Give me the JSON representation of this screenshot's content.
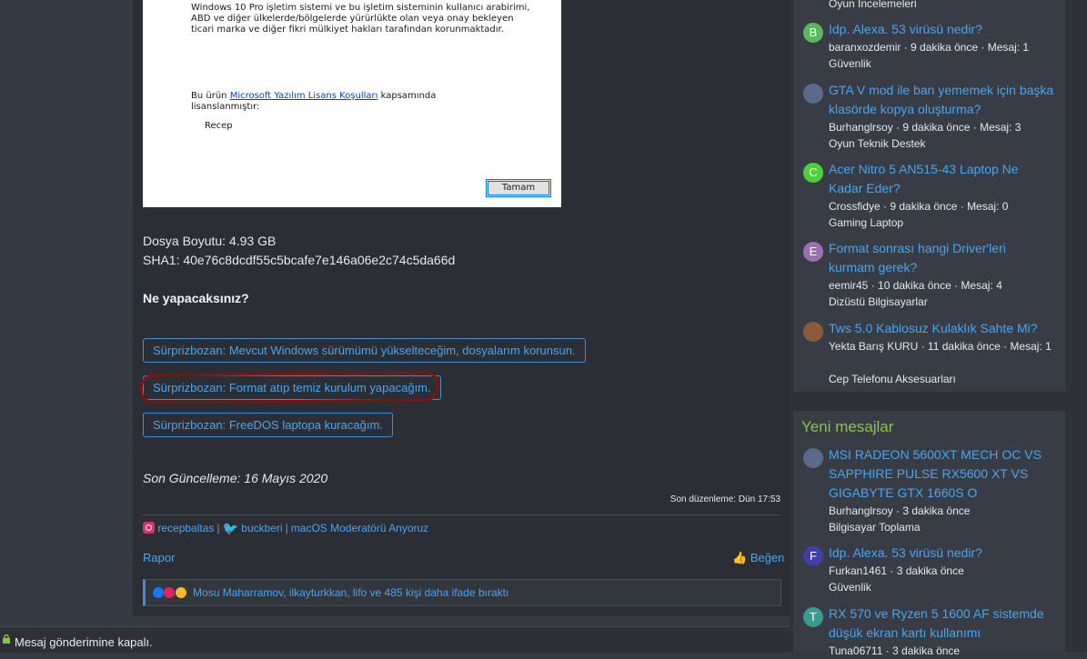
{
  "dialog": {
    "legal_text": "Windows 10 Pro işletim sistemi ve bu işletim sisteminin kullanıcı arabirimi, ABD ve diğer ülkelerde/bölgelerde yürürlükte olan veya onay bekleyen ticari marka ve diğer fikri mülkiyet hakları tarafından korunmaktadır.",
    "license_prefix": "Bu ürün ",
    "license_link": "Microsoft Yazılım Lisans Koşulları",
    "license_suffix": " kapsamında lisanslanmıştır:",
    "user": "Recep",
    "ok_label": "Tamam"
  },
  "post": {
    "file_size": "Dosya Boyutu: 4.93 GB",
    "sha1": "SHA1: 40e76c8dcdf55c5bcafe7e146a06e2c74c5da66d",
    "question": "Ne yapacaksınız?",
    "choices": [
      "Sürprizbozan: Mevcut Windows sürümümü yükselteceğim, dosyalarım korunsun.",
      "Sürprizbozan: Format atıp temiz kurulum yapacağım.",
      "Sürprizbozan: FreeDOS laptopa kuracağım."
    ],
    "last_update": "Son Güncelleme: 16 Mayıs 2020",
    "edited": "Son düzenleme: Dün 17:53",
    "signature": {
      "instagram": "recepbaltas",
      "twitter": "buckberi",
      "role": "macOS Moderatörü Anyoruz"
    },
    "report_label": "Rapor",
    "like_label": "Beğen",
    "reactions_text": "Mosu Maharramov, ilkayturkkan, lifo ve 485 kişi daha ifade bıraktı",
    "closed_text": "Mesaj gönderimine kapalı."
  },
  "sidebar": {
    "top_category": "Oyun İncelemeleri",
    "threads": [
      {
        "avatar": "B",
        "color": "#5cb85c",
        "title": "Idp. Alexa. 53 virüsü nedir?",
        "meta": "baranxozdemir · 9 dakika önce · Mesaj: 1",
        "category": "Güvenlik"
      },
      {
        "avatar": "",
        "color": "#5a6a8a",
        "title": "GTA V mod ile ban yememek için başka klasörde kopya oluşturma?",
        "meta": "Burhanglrsoy · 9 dakika önce · Mesaj: 3",
        "category": "Oyun Teknik Destek"
      },
      {
        "avatar": "C",
        "color": "#4cd137",
        "title": "Acer Nitro 5 AN515-43 Laptop Ne Kadar Eder?",
        "meta": "Crossfidye · 9 dakika önce · Mesaj: 0",
        "category": "Gaming Laptop"
      },
      {
        "avatar": "E",
        "color": "#9b6fb3",
        "title": "Format sonrası hangi Driver'leri kurmam gerek?",
        "meta": "eemir45 · 10 dakika önce · Mesaj: 4",
        "category": "Dizüstü Bilgisayarlar"
      },
      {
        "avatar": "",
        "color": "#8a5a3a",
        "title": "Tws 5.0 Kablosuz Kulaklık Sahte Mi?",
        "meta": "Yekta Barış KURU · 11 dakika önce · Mesaj: 1",
        "category": "Cep Telefonu Aksesuarları"
      }
    ],
    "new_messages_title": "Yeni mesajlar",
    "new_messages": [
      {
        "avatar": "",
        "color": "#5a6a8a",
        "title": "MSI RADEON 5600XT MECH OC VS SAPPHIRE PULSE RX5600 XT VS GIGABYTE GTX 1660S O",
        "meta": "Burhanglrsoy · 3 dakika önce",
        "category": "Bilgisayar Toplama"
      },
      {
        "avatar": "F",
        "color": "#3f3fa8",
        "title": "Idp. Alexa. 53 virüsü nedir?",
        "meta": "Furkan1461 · 3 dakika önce",
        "category": "Güvenlik"
      },
      {
        "avatar": "T",
        "color": "#3a9b8f",
        "title": "RX 570 ve Ryzen 5 1600 AF sistemde düşük ekran kartı kullanımı",
        "meta": "Tuna06711 · 3 dakika önce",
        "category": ""
      }
    ]
  }
}
